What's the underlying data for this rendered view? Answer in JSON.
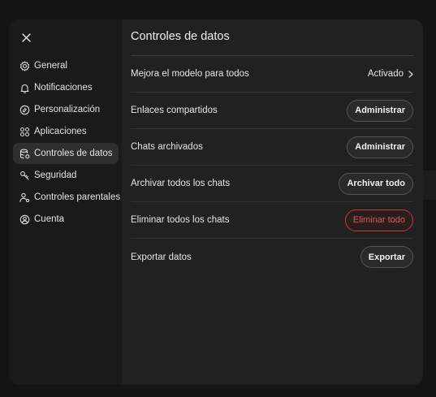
{
  "colors": {
    "danger": "#e05555",
    "background": "#212121",
    "sidebar": "#1a1a1a"
  },
  "close_icon": "close-icon",
  "sidebar": {
    "items": [
      {
        "label": "General",
        "icon": "gear-icon"
      },
      {
        "label": "Notificaciones",
        "icon": "bell-icon"
      },
      {
        "label": "Personalización",
        "icon": "palette-icon"
      },
      {
        "label": "Aplicaciones",
        "icon": "apps-grid-icon"
      },
      {
        "label": "Controles de datos",
        "icon": "database-gear-icon",
        "active": true
      },
      {
        "label": "Seguridad",
        "icon": "shield-key-icon"
      },
      {
        "label": "Controles parentales",
        "icon": "parental-icon"
      },
      {
        "label": "Cuenta",
        "icon": "user-circle-icon"
      }
    ]
  },
  "main": {
    "title": "Controles de datos",
    "rows": [
      {
        "label": "Mejora el modelo para todos",
        "value": "Activado"
      },
      {
        "label": "Enlaces compartidos",
        "button": "Administrar"
      },
      {
        "label": "Chats archivados",
        "button": "Administrar"
      },
      {
        "label": "Archivar todos los chats",
        "button": "Archivar todo"
      },
      {
        "label": "Eliminar todos los chats",
        "button": "Eliminar todo"
      },
      {
        "label": "Exportar datos",
        "button": "Exportar"
      }
    ]
  }
}
